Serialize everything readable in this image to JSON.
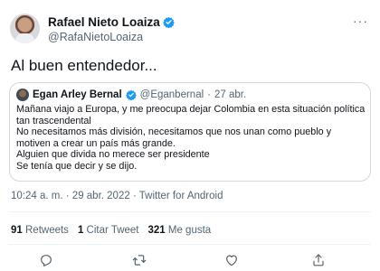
{
  "author": {
    "name": "Rafael Nieto Loaiza",
    "handle": "@RafaNietoLoaiza",
    "more": "···"
  },
  "tweet": {
    "text": "Al buen entendedor..."
  },
  "quoted": {
    "name": "Egan Arley Bernal",
    "handle": "@Eganbernal",
    "dot": "·",
    "date": "27 abr.",
    "lines": [
      "Mañana viajo a Europa, y me preocupa dejar Colombia en esta situación política",
      "tan trascendental",
      "No necesitamos más división, necesitamos que nos unan como pueblo y",
      "motiven a crear un país más grande.",
      "Alguien que divida no merece ser presidente",
      "Se tenía que decir y se dijo."
    ]
  },
  "meta": {
    "time": "10:24 a. m.",
    "sep1": "·",
    "date": "29 abr. 2022",
    "sep2": "·",
    "source": "Twitter for Android"
  },
  "stats": {
    "retweets_count": "91",
    "retweets_label": "Retweets",
    "quotes_count": "1",
    "quotes_label": "Citar Tweet",
    "likes_count": "321",
    "likes_label": "Me gusta"
  },
  "colors": {
    "accent": "#1d9bf0",
    "muted": "#536471",
    "border": "#cfd9de"
  },
  "icons": [
    "verified-badge-icon",
    "more-icon",
    "reply-icon",
    "retweet-icon",
    "like-icon",
    "share-icon"
  ]
}
